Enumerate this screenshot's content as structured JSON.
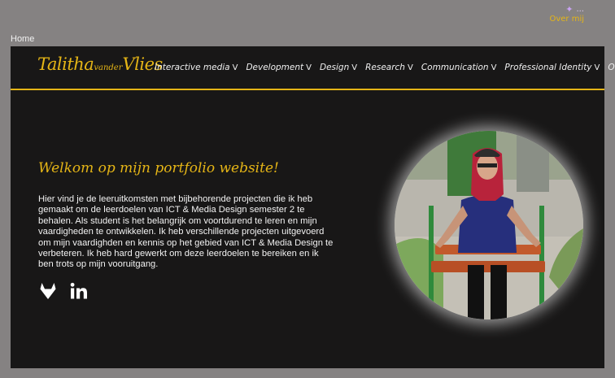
{
  "top_link": {
    "ellipsis": "...",
    "label": "Over mij"
  },
  "breadcrumb": "Home",
  "logo": {
    "part1": "Talitha",
    "part2": "vander",
    "part3": "Vlies"
  },
  "nav": [
    {
      "label": "Interactive media",
      "chevron": "V"
    },
    {
      "label": "Development",
      "chevron": "V"
    },
    {
      "label": "Design",
      "chevron": "V"
    },
    {
      "label": "Research",
      "chevron": "V"
    },
    {
      "label": "Communication",
      "chevron": "V"
    },
    {
      "label": "Professional Identity",
      "chevron": "V"
    },
    {
      "label": "Over mij",
      "chevron": ""
    }
  ],
  "welcome": "Welkom op mijn portfolio website!",
  "intro": "Hier vind je de leeruitkomsten met bijbehorende projecten die ik heb gemaakt om de leerdoelen van ICT & Media Design semester 2 te behalen. Als student is het belangrijk om voortdurend te leren en mijn vaardigheden te ontwikkelen. Ik heb verschillende projecten uitgevoerd om mijn vaardighden en kennis op het gebied van ICT & Media Design te verbeteren. Ik heb hard gewerkt om deze leerdoelen te bereiken en ik ben trots op mijn vooruitgang.",
  "socials": [
    {
      "icon": "gitlab-icon"
    },
    {
      "icon": "linkedin-icon"
    }
  ],
  "colors": {
    "accent": "#e5b516",
    "background": "#181717",
    "page": "#858282"
  }
}
